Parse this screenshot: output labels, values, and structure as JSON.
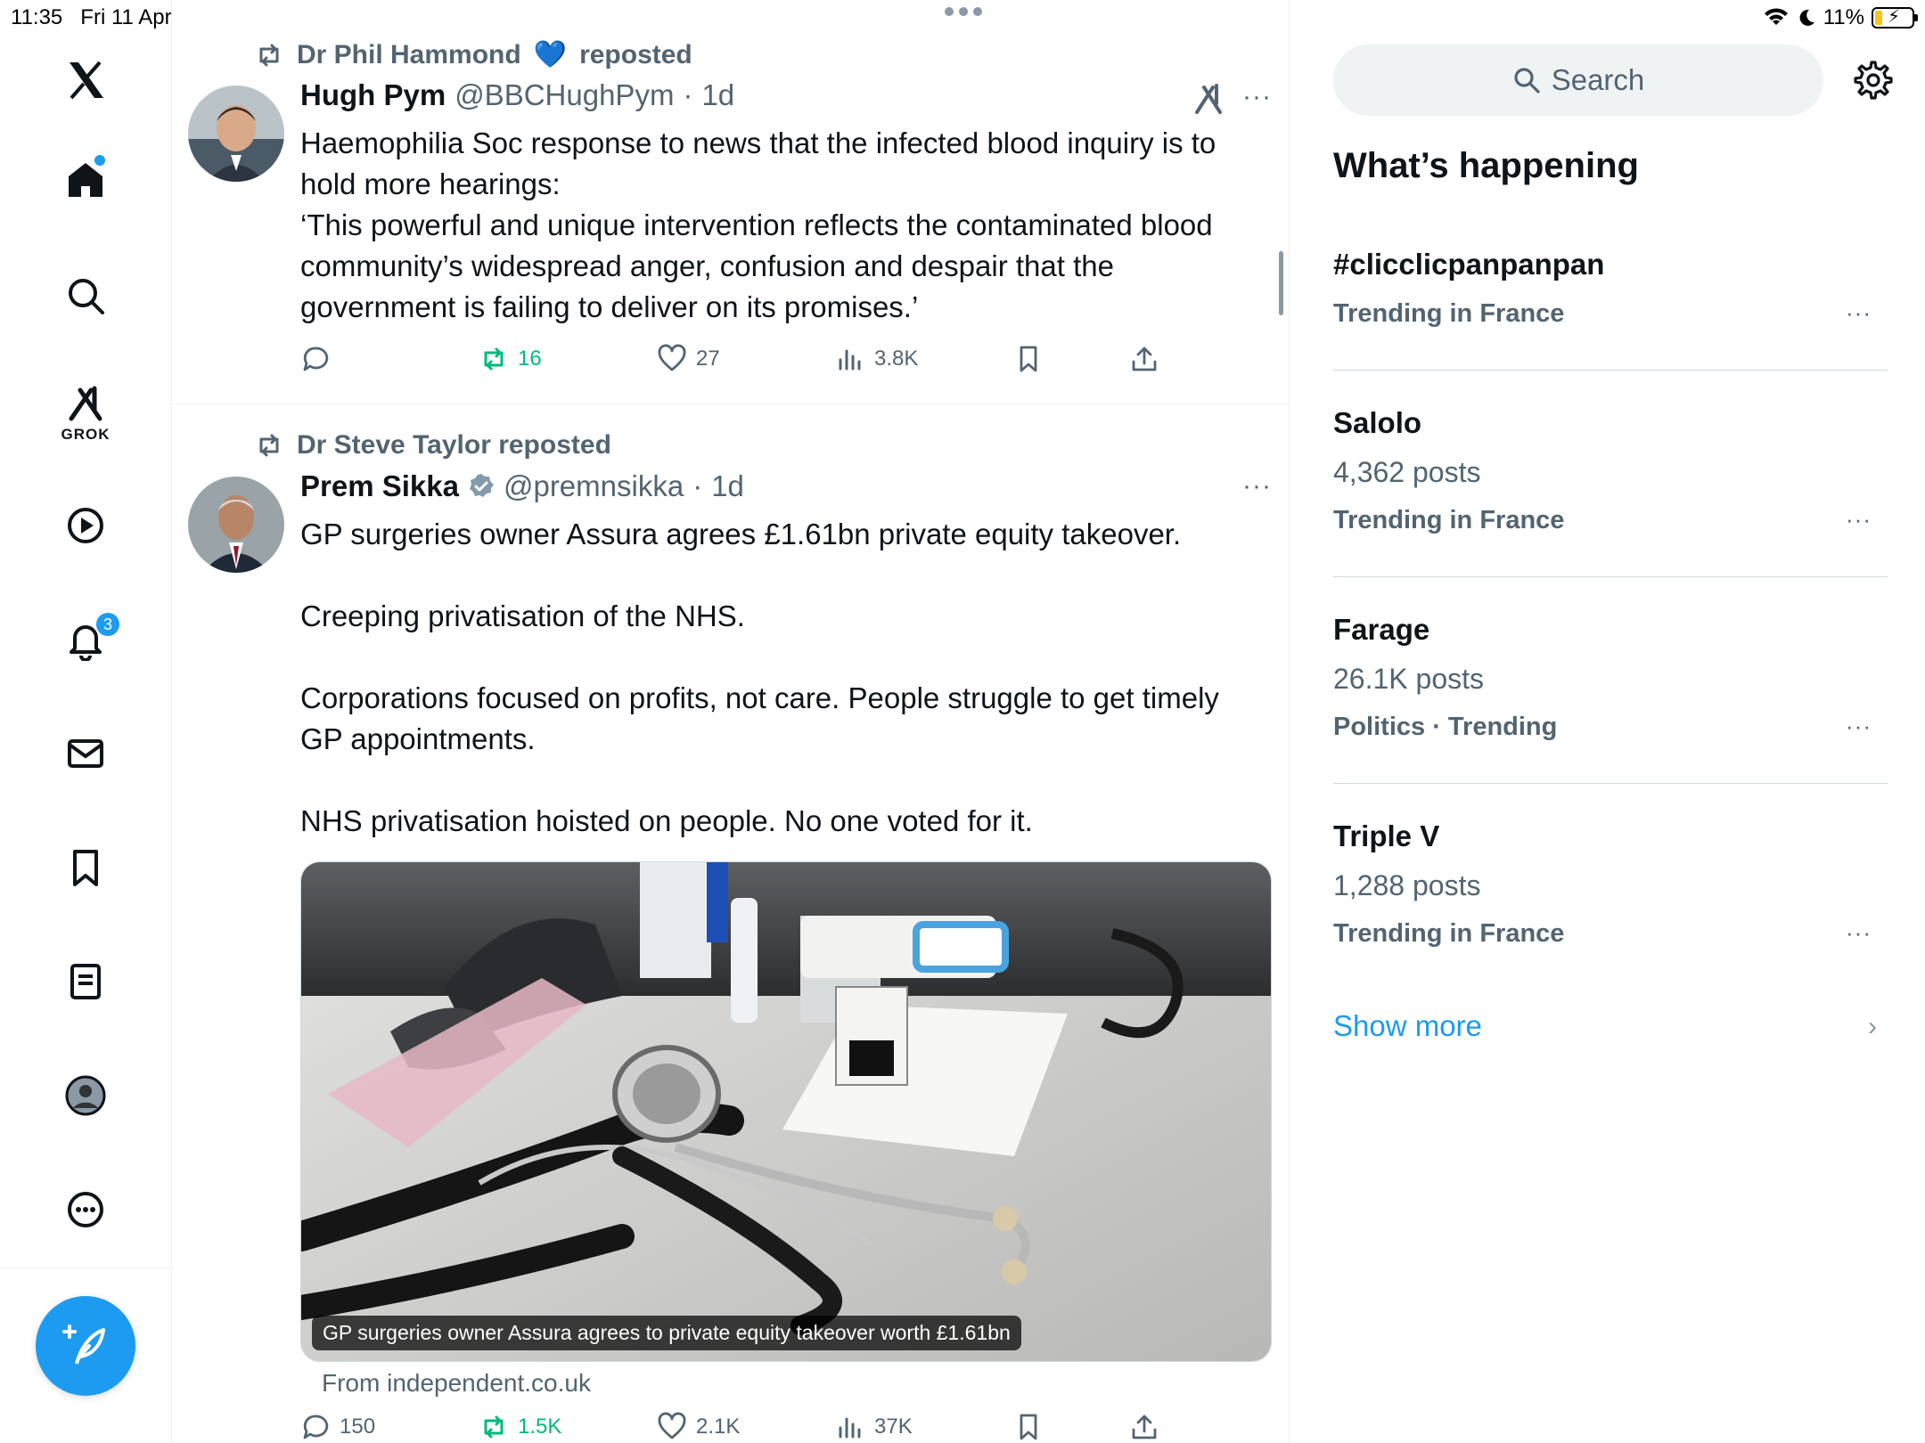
{
  "status_bar": {
    "time": "11:35",
    "date": "Fri 11 Apr",
    "battery": "11%"
  },
  "nav": {
    "items": [
      "x-logo",
      "home",
      "search",
      "grok",
      "videos",
      "notifications",
      "messages",
      "bookmarks",
      "lists",
      "profile",
      "more"
    ],
    "grok_label": "GROK",
    "notifications_badge": "3",
    "compose": "compose-post"
  },
  "feed": {
    "tweets": [
      {
        "repost_by": "Dr Phil Hammond",
        "repost_emoji": "💙",
        "repost_suffix": "reposted",
        "name": "Hugh Pym",
        "handle": "@BBCHughPym",
        "sep": "·",
        "time": "1d",
        "text": "Haemophilia Soc response to news that the infected blood inquiry is to hold more hearings:\n‘This powerful and unique intervention reflects the contaminated blood community’s widespread anger, confusion and despair that the government is failing to deliver on its promises.’",
        "replies": "",
        "reposts": "16",
        "likes": "27",
        "views": "3.8K"
      },
      {
        "repost_by": "Dr Steve Taylor reposted",
        "name": "Prem Sikka",
        "handle": "@premnsikka",
        "sep": "·",
        "time": "1d",
        "text": "GP surgeries owner Assura agrees £1.61bn private equity takeover.\n\nCreeping privatisation of the NHS.\n\nCorporations focused on profits, not care. People struggle to get timely GP appointments.\n\nNHS privatisation hoisted on people. No one voted for it.",
        "media_caption": "GP surgeries owner Assura agrees to private equity takeover worth £1.61bn",
        "media_source": "From independent.co.uk",
        "replies": "150",
        "reposts": "1.5K",
        "likes": "2.1K",
        "views": "37K"
      }
    ]
  },
  "right": {
    "search_placeholder": "Search",
    "heading": "What’s happening",
    "trends": [
      {
        "name": "#clicclicpanpanpan",
        "posts": "",
        "meta": "Trending in France"
      },
      {
        "name": "Salolo",
        "posts": "4,362 posts",
        "meta": "Trending in France"
      },
      {
        "name": "Farage",
        "posts": "26.1K posts",
        "meta": "Politics · Trending"
      },
      {
        "name": "Triple V",
        "posts": "1,288 posts",
        "meta": "Trending in France"
      }
    ],
    "show_more": "Show more",
    "more_glyph": "···",
    "chevron": "›"
  },
  "colors": {
    "accent": "#1d9bf0",
    "muted": "#536471",
    "repost_green": "#00ba7c",
    "text": "#0f1419"
  }
}
